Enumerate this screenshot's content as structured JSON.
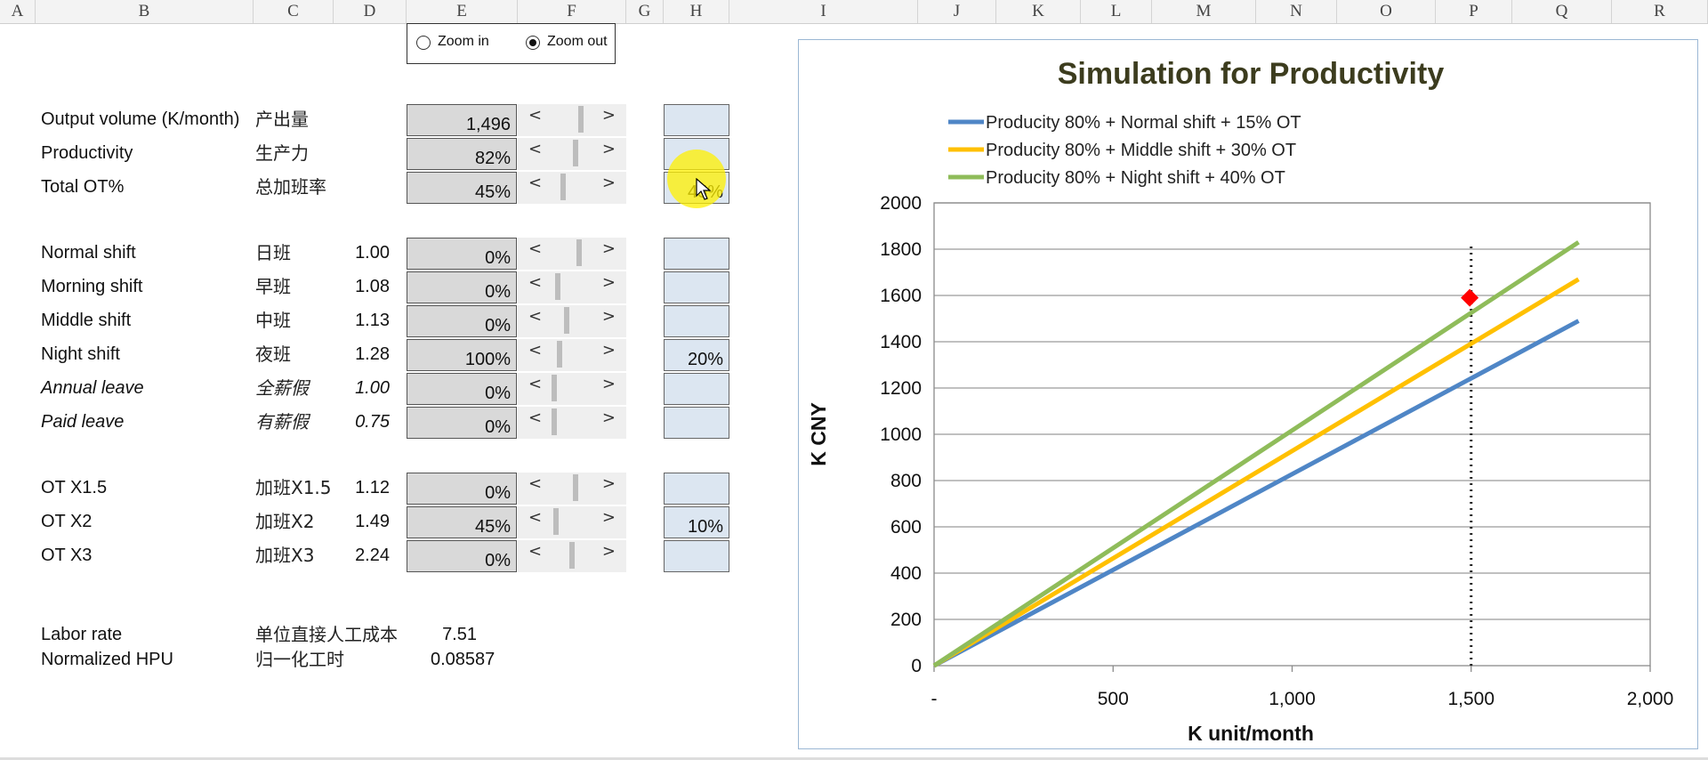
{
  "columns": [
    "A",
    "B",
    "C",
    "D",
    "E",
    "F",
    "G",
    "H",
    "I",
    "J",
    "K",
    "L",
    "M",
    "N",
    "O",
    "P",
    "Q",
    "R"
  ],
  "zoom_control": {
    "zoom_in_label": "Zoom in",
    "zoom_out_label": "Zoom out",
    "selected": "Zoom out"
  },
  "rows_top": [
    {
      "label": "Output volume (K/month)",
      "cn": "产出量",
      "value": "1,496",
      "blue": ""
    },
    {
      "label": "Productivity",
      "cn": "生产力",
      "value": "82%",
      "blue": ""
    },
    {
      "label": "Total OT%",
      "cn": "总加班率",
      "value": "45%",
      "blue": "45%"
    }
  ],
  "rows_shift": [
    {
      "label": "Normal shift",
      "cn": "日班",
      "factor": "1.00",
      "value": "0%",
      "blue": ""
    },
    {
      "label": "Morning shift",
      "cn": "早班",
      "factor": "1.08",
      "value": "0%",
      "blue": ""
    },
    {
      "label": "Middle shift",
      "cn": "中班",
      "factor": "1.13",
      "value": "0%",
      "blue": ""
    },
    {
      "label": "Night shift",
      "cn": "夜班",
      "factor": "1.28",
      "value": "100%",
      "blue": "20%"
    },
    {
      "label": "Annual leave",
      "cn": "全薪假",
      "factor": "1.00",
      "value": "0%",
      "blue": ""
    },
    {
      "label": "Paid leave",
      "cn": "有薪假",
      "factor": "0.75",
      "value": "0%",
      "blue": ""
    }
  ],
  "rows_ot": [
    {
      "label": "OT X1.5",
      "cn": "加班X1.5",
      "factor": "1.12",
      "value": "0%",
      "blue": ""
    },
    {
      "label": "OT X2",
      "cn": "加班X2",
      "factor": "1.49",
      "value": "45%",
      "blue": "10%"
    },
    {
      "label": "OT X3",
      "cn": "加班X3",
      "factor": "2.24",
      "value": "0%",
      "blue": ""
    }
  ],
  "bottom": [
    {
      "label": "Labor rate",
      "cn": "单位直接人工成本",
      "value": "7.51"
    },
    {
      "label": "Normalized HPU",
      "cn": "归一化工时",
      "value": "0.08587"
    }
  ],
  "spinner": {
    "left": "<",
    "right": ">"
  },
  "colors": {
    "normal": "#4f86c6",
    "middle": "#ffc000",
    "night": "#8fbc5a",
    "marker": "#ff0000",
    "title": "#3c3c1e"
  },
  "chart_data": {
    "type": "line",
    "title": "Simulation for Productivity",
    "xlabel": "K unit/month",
    "ylabel": "K CNY",
    "xlim": [
      0,
      2000
    ],
    "ylim": [
      0,
      2000
    ],
    "xticks": [
      "-",
      "500",
      "1,000",
      "1,500",
      "2,000"
    ],
    "yticks": [
      "0",
      "200",
      "400",
      "600",
      "800",
      "1000",
      "1200",
      "1400",
      "1600",
      "1800",
      "2000"
    ],
    "grid": true,
    "legend": "top-left",
    "series": [
      {
        "name": "Producity 80% + Normal shift + 15% OT",
        "x": [
          0,
          1800
        ],
        "y": [
          0,
          1490
        ]
      },
      {
        "name": "Producity 80% + Middle shift + 30% OT",
        "x": [
          0,
          1800
        ],
        "y": [
          0,
          1670
        ]
      },
      {
        "name": "Producity 80% + Night shift + 40% OT",
        "x": [
          0,
          1800
        ],
        "y": [
          0,
          1830
        ]
      }
    ],
    "marker": {
      "x": 1496,
      "y": 1590
    },
    "vline_x": 1500
  }
}
